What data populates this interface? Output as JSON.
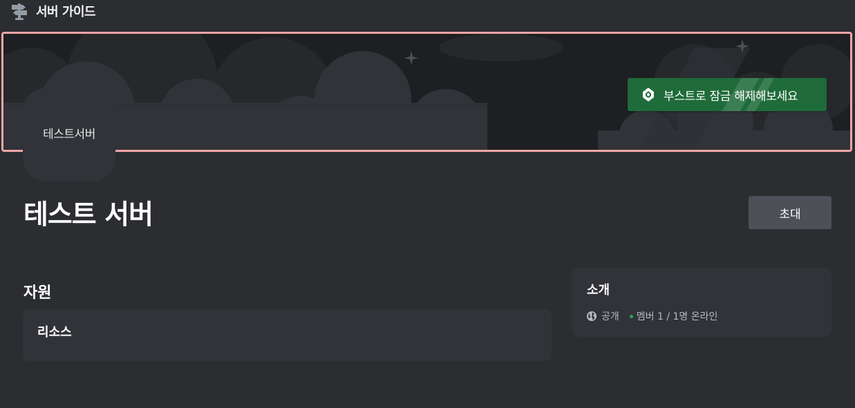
{
  "header": {
    "title": "서버 가이드",
    "icon": "signpost-icon"
  },
  "banner": {
    "boost_label": "부스트로 잠금 해제해보세요",
    "boost_icon": "boost-gem-icon",
    "boost_color": "#1f6b3a"
  },
  "server": {
    "icon_text": "테스트서버",
    "name": "테스트 서버",
    "invite_label": "초대"
  },
  "resources": {
    "heading": "자원",
    "card_title": "리소스"
  },
  "about": {
    "title": "소개",
    "visibility": "공개",
    "visibility_icon": "globe-icon",
    "members": "멤버 1 / 1명 온라인",
    "online_color": "#23a55a"
  }
}
